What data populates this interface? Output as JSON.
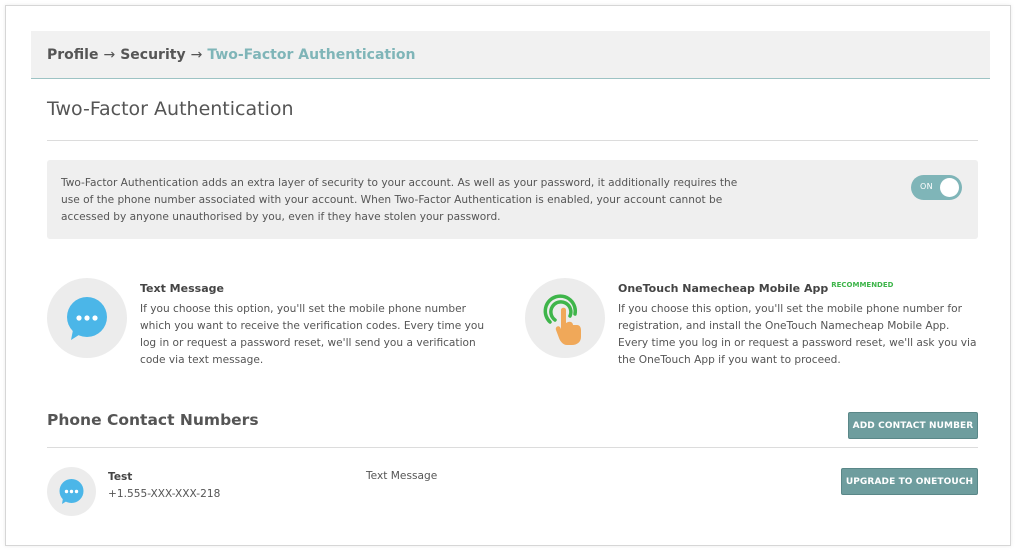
{
  "breadcrumb": {
    "items": [
      "Profile",
      "Security"
    ],
    "separator": "→",
    "current": "Two-Factor Authentication"
  },
  "page": {
    "title": "Two-Factor Authentication"
  },
  "info": {
    "text": "Two-Factor Authentication adds an extra layer of security to your account. As well as your password, it additionally requires the use of the phone number associated with your account. When Two-Factor Authentication is enabled, your account cannot be accessed by anyone unauthorised by you, even if they have stolen your password.",
    "toggle_label": "ON"
  },
  "options": {
    "sms": {
      "title": "Text Message",
      "description": "If you choose this option, you'll set the mobile phone number which you want to receive the verification codes. Every time you log in or request a password reset, we'll send you a verification code via text message."
    },
    "app": {
      "title": "OneTouch Namecheap Mobile App",
      "badge": "RECOMMENDED",
      "description": "If you choose this option, you'll set the mobile phone number for registration, and install the OneTouch Namecheap Mobile App. Every time you log in or request a password reset, we'll ask you via the OneTouch App if you want to proceed."
    }
  },
  "contacts": {
    "title": "Phone Contact Numbers",
    "add_button": "ADD CONTACT NUMBER",
    "rows": [
      {
        "name": "Test",
        "phone": "+1.555-XXX-XXX-218",
        "method": "Text Message",
        "action": "UPGRADE TO ONETOUCH"
      }
    ]
  },
  "icons": {
    "chat": "chat-bubble-icon",
    "touch": "touch-hand-icon"
  },
  "colors": {
    "accent": "#7fb5b8",
    "button": "#6e9d9e",
    "chat_icon": "#4bb6e8",
    "touch_ring": "#3eb54a",
    "hand": "#f0a859",
    "badge": "#3eb54a"
  }
}
